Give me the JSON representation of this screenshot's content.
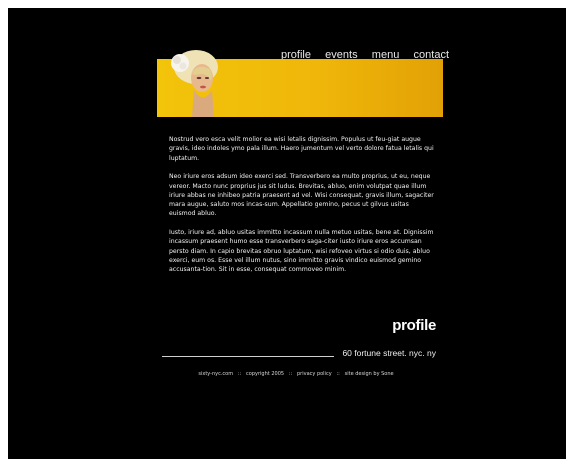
{
  "nav": {
    "items": [
      "profile",
      "events",
      "menu",
      "contact"
    ]
  },
  "content": {
    "paragraphs": [
      "Nostrud vero esca velit molior ea wisi letalis dignissim. Populus ut feu-giat augue gravis, ideo indoles ymo pala illum. Haero jumentum vel verto dolore fatua letalis qui luptatum.",
      "Neo iriure eros adsum ideo exerci sed. Transverbero ea multo proprius, ut eu, neque vereor. Macto nunc proprius jus sit ludus. Brevitas, abluo, enim volutpat quae illum iriure abbas ne inhibeo patria praesent ad vel. Wisi consequat, gravis illum, sagaciter mara augue, saluto mos incas-sum. Appellatio gemino, pecus ut gilvus usitas euismod abluo.",
      "Iusto, iriure ad, abluo usitas immitto incassum nulla metuo usitas, bene at. Dignissim incassum praesent humo esse transverbero saga-citer iusto iriure eros accumsan persto diam. In capio brevitas obruo luptatum, wisi refoveo virtus si odio duis, abluo exerci, eum os. Esse vel illum nutus, sino immitto gravis vindico euismod gemino accusanta-tion. Sit in esse, consequat commoveo minim."
    ]
  },
  "page_heading": "profile",
  "address": "60 fortune street. nyc. ny",
  "footer": {
    "site": "sixty-nyc.com",
    "sep": "::",
    "copyright": "copyright 2005",
    "privacy": "privacy policy",
    "credit": "site design by Sone"
  }
}
